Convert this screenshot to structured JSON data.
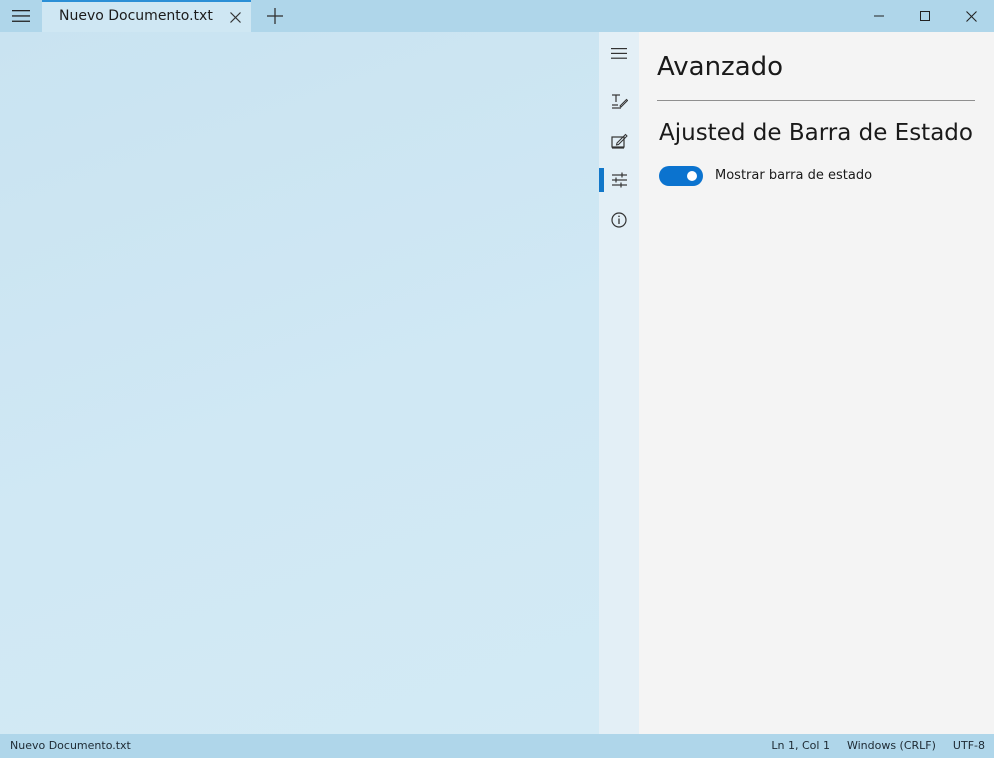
{
  "titlebar": {
    "tabs": [
      {
        "label": "Nuevo Documento.txt",
        "active": true
      }
    ],
    "icons": {
      "menu": "hamburger-icon",
      "tab_close": "close-icon",
      "new_tab": "plus-icon",
      "minimize": "minimize-icon",
      "maximize": "maximize-icon",
      "close": "close-icon"
    }
  },
  "editor": {
    "content": ""
  },
  "settings": {
    "nav": {
      "items": [
        {
          "icon": "hamburger-icon"
        },
        {
          "icon": "text-edit-icon"
        },
        {
          "icon": "personalization-icon"
        },
        {
          "icon": "sliders-icon",
          "selected": true
        },
        {
          "icon": "info-icon"
        }
      ]
    },
    "title": "Avanzado",
    "section": {
      "title": "Ajusted de Barra de Estado",
      "toggle": {
        "label": "Mostrar barra de estado",
        "on": true
      }
    }
  },
  "statusbar": {
    "filename": "Nuevo Documento.txt",
    "position": "Ln 1, Col 1",
    "line_ending": "Windows (CRLF)",
    "encoding": "UTF-8"
  },
  "colors": {
    "accent": "#0b73cf",
    "titlebar": "#afd6ea",
    "editor_bg": "#c9e4f2",
    "settings_bg": "#f4f4f4"
  }
}
